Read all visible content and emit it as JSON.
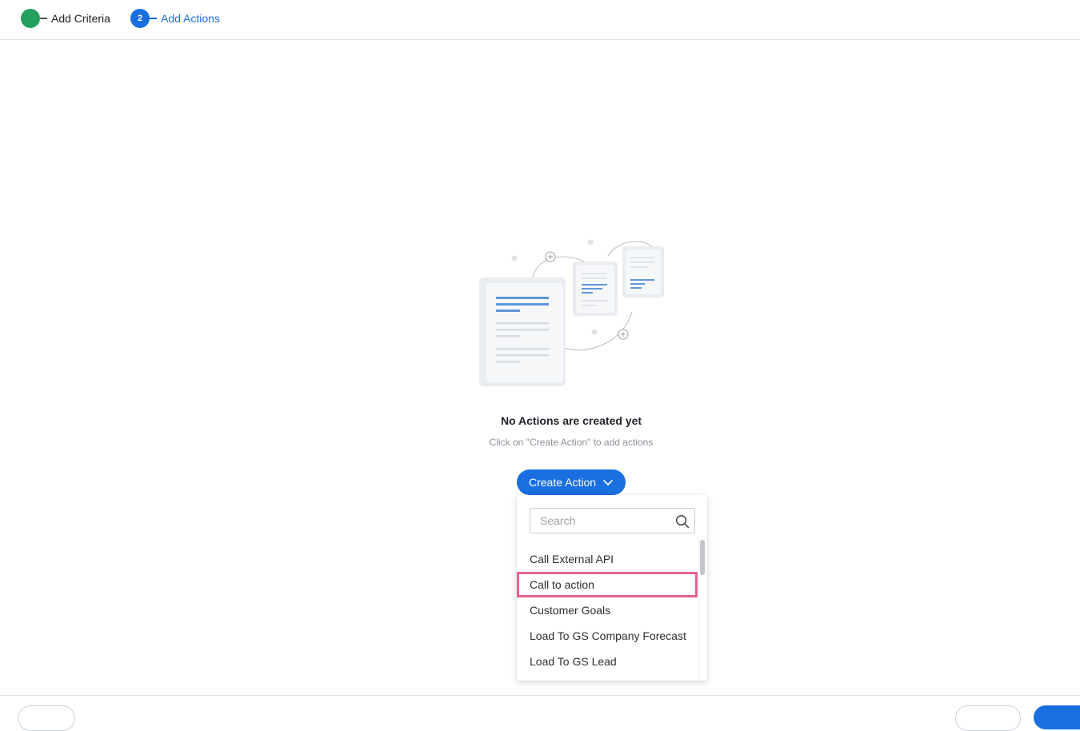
{
  "stepper": {
    "steps": [
      {
        "label": "Add Criteria",
        "status": "done",
        "number": ""
      },
      {
        "label": "Add Actions",
        "status": "active",
        "number": "2"
      }
    ]
  },
  "empty_state": {
    "title": "No Actions are created yet",
    "subtitle": "Click on \"Create Action\" to add actions"
  },
  "create_action": {
    "label": "Create Action"
  },
  "dropdown": {
    "search_placeholder": "Search",
    "search_value": "",
    "highlighted_item": "Call to action",
    "items": [
      {
        "label": "Call External API"
      },
      {
        "label": "Call to action"
      },
      {
        "label": "Customer Goals"
      },
      {
        "label": "Load To GS Company Forecast"
      },
      {
        "label": "Load To GS Lead"
      }
    ]
  },
  "colors": {
    "primary": "#1a6fe0",
    "done": "#23a05c",
    "highlight": "#e26294"
  }
}
